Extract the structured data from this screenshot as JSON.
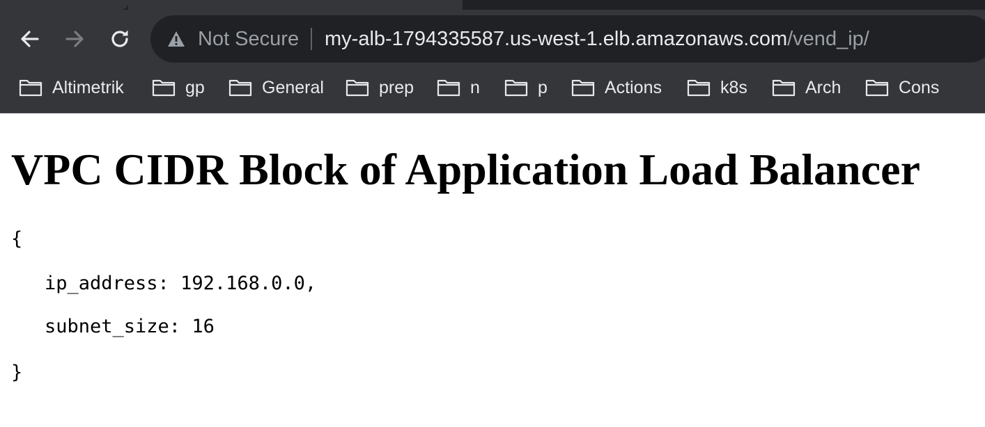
{
  "browser": {
    "security_label": "Not Secure",
    "url_host": "my-alb-1794335587.us-west-1.elb.amazonaws.com",
    "url_path": "/vend_ip/",
    "icons": {
      "back": "back-arrow-icon",
      "forward": "forward-arrow-icon",
      "reload": "reload-icon",
      "warning": "warning-icon",
      "folder": "folder-icon"
    },
    "colors": {
      "chrome_bg": "#35363a",
      "omnibox_bg": "#202124",
      "text_light": "#e8eaed",
      "text_dim": "#9aa0a6"
    }
  },
  "bookmarks": [
    {
      "label": "Altimetrik"
    },
    {
      "label": "gp"
    },
    {
      "label": "General"
    },
    {
      "label": "prep"
    },
    {
      "label": "n"
    },
    {
      "label": "p"
    },
    {
      "label": "Actions"
    },
    {
      "label": "k8s"
    },
    {
      "label": "Arch"
    },
    {
      "label": "Cons"
    }
  ],
  "page": {
    "title": "VPC CIDR Block of Application Load Balancer",
    "json_open": "{",
    "lines": [
      {
        "text": "ip_address: 192.168.0.0,"
      },
      {
        "text": "subnet_size: 16"
      }
    ],
    "json_close": "}"
  }
}
